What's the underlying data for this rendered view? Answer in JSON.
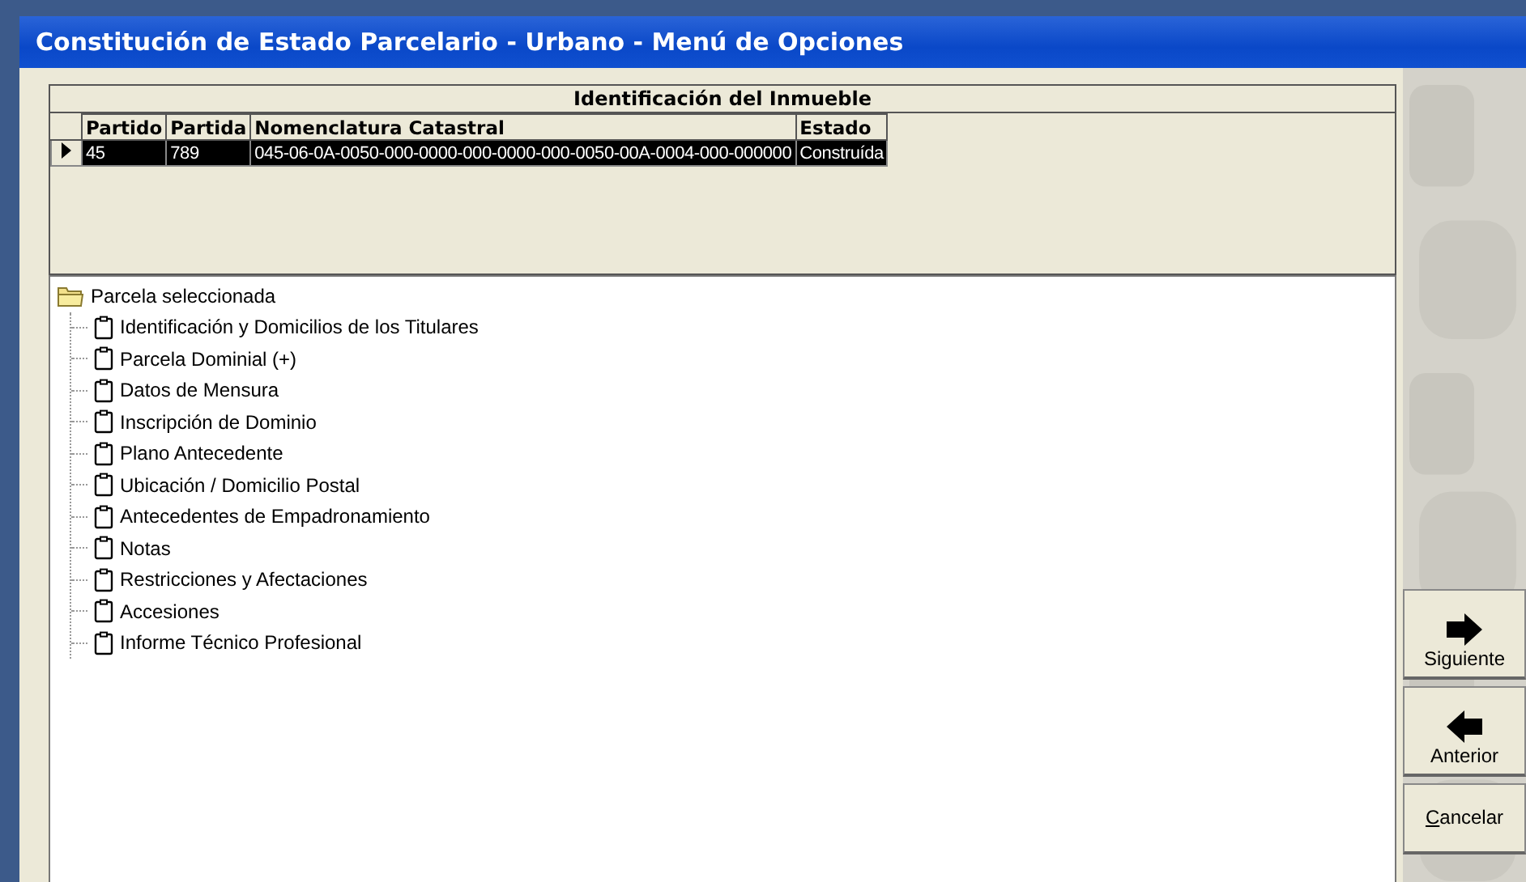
{
  "window": {
    "title": "Constitución de Estado Parcelario - Urbano - Menú de Opciones"
  },
  "grid": {
    "caption": "Identificación del Inmueble",
    "columns": [
      "Partido",
      "Partida",
      "Nomenclatura Catastral",
      "Estado"
    ],
    "rows": [
      {
        "cells": [
          "45",
          "789",
          "045-06-0A-0050-000-0000-000-0000-000-0050-00A-0004-000-000000",
          "Construída"
        ],
        "selected": true
      }
    ]
  },
  "tree": {
    "label": "Parcela seleccionada",
    "children": [
      {
        "label": "Identificación y Domicilios de los Titulares"
      },
      {
        "label": "Parcela Dominial (+)"
      },
      {
        "label": "Datos de Mensura"
      },
      {
        "label": "Inscripción de Dominio"
      },
      {
        "label": "Plano Antecedente"
      },
      {
        "label": "Ubicación / Domicilio Postal"
      },
      {
        "label": "Antecedentes de Empadronamiento"
      },
      {
        "label": "Notas"
      },
      {
        "label": "Restricciones y Afectaciones"
      },
      {
        "label": "Accesiones"
      },
      {
        "label": "Informe Técnico Profesional"
      }
    ]
  },
  "buttons": [
    {
      "label": "Siguiente",
      "kind": "next"
    },
    {
      "label": "Anterior",
      "kind": "prev"
    },
    {
      "label": "Cancelar",
      "kind": "plain"
    }
  ]
}
